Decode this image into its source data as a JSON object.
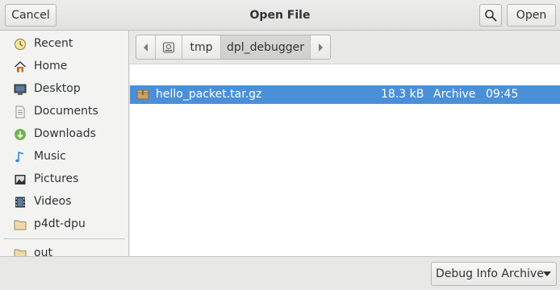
{
  "header": {
    "title": "Open File",
    "cancel_label": "Cancel",
    "open_label": "Open",
    "search_icon": "search-icon"
  },
  "sidebar": {
    "items": [
      {
        "label": "Recent",
        "icon": "recent-icon"
      },
      {
        "label": "Home",
        "icon": "home-icon"
      },
      {
        "label": "Desktop",
        "icon": "desktop-icon"
      },
      {
        "label": "Documents",
        "icon": "documents-icon"
      },
      {
        "label": "Downloads",
        "icon": "downloads-icon"
      },
      {
        "label": "Music",
        "icon": "music-icon"
      },
      {
        "label": "Pictures",
        "icon": "pictures-icon"
      },
      {
        "label": "Videos",
        "icon": "videos-icon"
      },
      {
        "label": "p4dt-dpu",
        "icon": "folder-icon"
      },
      {
        "label": "out",
        "icon": "folder-icon"
      }
    ]
  },
  "pathbar": {
    "segments": [
      "tmp",
      "dpl_debugger"
    ],
    "active": "dpl_debugger"
  },
  "files": [
    {
      "name": "hello_packet.tar.gz",
      "size": "18.3 kB",
      "type": "Archive",
      "modified": "09:45",
      "selected": true
    }
  ],
  "footer": {
    "filter_label": "Debug Info Archive"
  },
  "colors": {
    "selection": "#4a90d9",
    "accent": "#4a90d9"
  }
}
